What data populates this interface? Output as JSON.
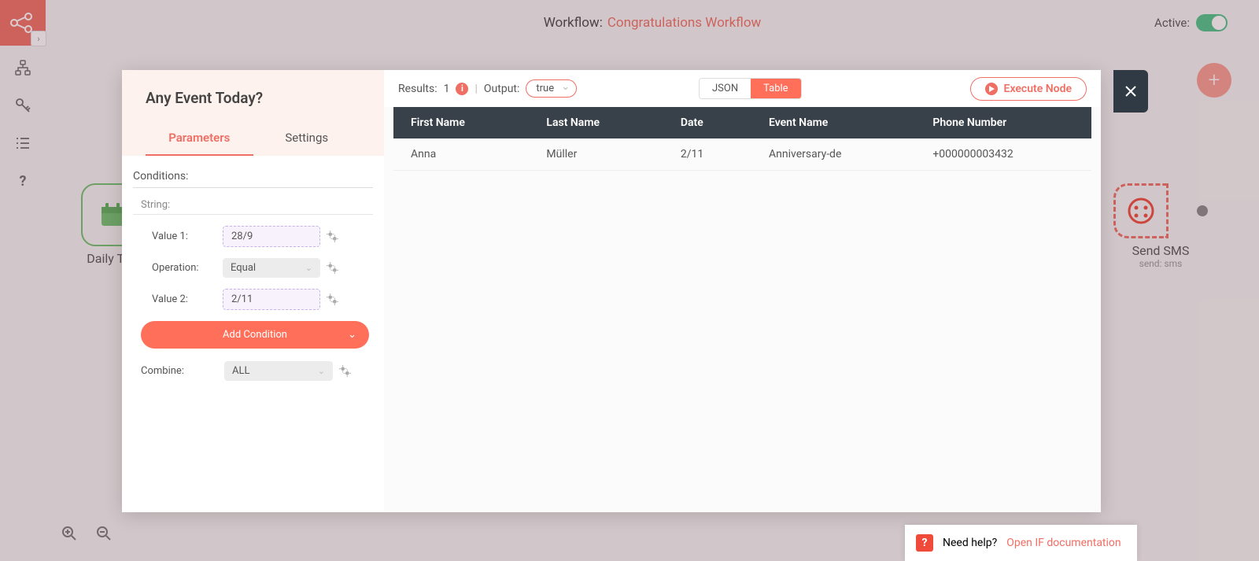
{
  "topbar": {
    "prefix": "Workflow:",
    "name": "Congratulations Workflow",
    "active_label": "Active:"
  },
  "rail": {
    "icons": [
      "workflow-icon",
      "key-icon",
      "list-icon",
      "help-icon"
    ]
  },
  "canvas": {
    "daily": {
      "label": "Daily Trig"
    },
    "sms": {
      "label": "Send SMS",
      "sub": "send: sms"
    }
  },
  "modal": {
    "title": "Any Event Today?",
    "tabs": {
      "params": "Parameters",
      "settings": "Settings"
    },
    "conditions_label": "Conditions:",
    "string_label": "String:",
    "rows": {
      "value1": {
        "label": "Value 1:",
        "value": "28/9"
      },
      "operation": {
        "label": "Operation:",
        "value": "Equal"
      },
      "value2": {
        "label": "Value 2:",
        "value": "2/11"
      }
    },
    "add_condition": "Add Condition",
    "combine": {
      "label": "Combine:",
      "value": "ALL"
    }
  },
  "results": {
    "label": "Results:",
    "count": "1",
    "output_label": "Output:",
    "output_value": "true",
    "view": {
      "json": "JSON",
      "table": "Table"
    },
    "execute": "Execute Node",
    "columns": [
      "First Name",
      "Last Name",
      "Date",
      "Event Name",
      "Phone Number"
    ],
    "row": {
      "first": "Anna",
      "last": "Müller",
      "date": "2/11",
      "event": "Anniversary-de",
      "phone": "+000000003432"
    }
  },
  "help": {
    "text": "Need help?",
    "link": "Open IF documentation"
  }
}
